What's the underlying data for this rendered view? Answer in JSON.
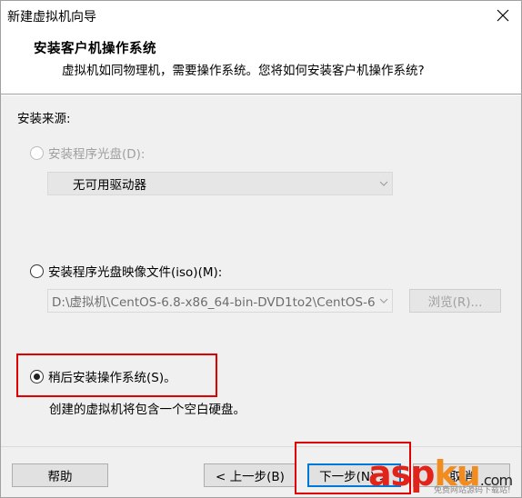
{
  "window": {
    "title": "新建虚拟机向导"
  },
  "header": {
    "title": "安装客户机操作系统",
    "subtitle": "虚拟机如同物理机，需要操作系统。您将如何安装客户机操作系统?"
  },
  "install_source": {
    "label": "安装来源:",
    "options": [
      {
        "label": "安装程序光盘(D):",
        "checked": false,
        "enabled": false
      },
      {
        "label": "安装程序光盘映像文件(iso)(M):",
        "checked": false,
        "enabled": true
      },
      {
        "label": "稍后安装操作系统(S)。",
        "checked": true,
        "enabled": true
      }
    ],
    "disc_drive": {
      "value": "无可用驱动器",
      "enabled": false
    },
    "iso_path": {
      "value": "D:\\虚拟机\\CentOS-6.8-x86_64-bin-DVD1to2\\CentOS-6",
      "enabled": false
    },
    "browse_label": "浏览(R)...",
    "later_description": "创建的虚拟机将包含一个空白硬盘。"
  },
  "footer": {
    "help_label": "帮助",
    "back_label": "< 上一步(B)",
    "next_label": "下一步(N) >",
    "cancel_label": "取消"
  },
  "watermark": {
    "brand": "aspku",
    "tld": ".com",
    "tagline": "免费网站源码下载站!"
  },
  "colors": {
    "highlight": "#e00000",
    "primary_border": "#0078d7",
    "watermark_orange": "#f28c1e",
    "watermark_red": "#e2231a"
  }
}
